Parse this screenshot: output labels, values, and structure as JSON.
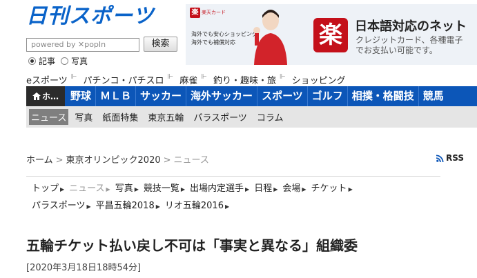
{
  "header": {
    "logo": "日刊スポーツ",
    "search_placeholder": "powered by ✕popIn",
    "search_button": "検索",
    "radio_options": [
      "記事",
      "写真"
    ],
    "radio_selected": 0
  },
  "ad": {
    "badge": "楽",
    "badge_text": "楽天カード",
    "small_lines": [
      "海外でも安心ショッピング",
      "海外でも補償対応"
    ],
    "title": "日本語対応のネット",
    "subtitle": [
      "クレジットカード、各種電子",
      "でお支払い可能です。"
    ],
    "logo_char": "楽"
  },
  "subnav": [
    "eスポーツ",
    "パチンコ・パチスロ",
    "麻雀",
    "釣り・趣味・旅",
    "ショッピング"
  ],
  "mainnav": {
    "home": "ホ…",
    "items": [
      "野球",
      "ＭＬＢ",
      "サッカー",
      "海外サッカー",
      "スポーツ",
      "ゴルフ",
      "相撲・格闘技",
      "競馬"
    ]
  },
  "subnav2": {
    "active": "ニュース",
    "items": [
      "写真",
      "紙面特集",
      "東京五輪",
      "パラスポーツ",
      "コラム"
    ]
  },
  "breadcrumb": {
    "home": "ホーム",
    "section": "東京オリンピック2020",
    "current": "ニュース",
    "rss": "RSS"
  },
  "secnav": {
    "row1": [
      "トップ",
      "ニュース",
      "写真",
      "競技一覧",
      "出場内定選手",
      "日程",
      "会場",
      "チケット"
    ],
    "row1_dim_index": 1,
    "row2": [
      "パラスポーツ",
      "平昌五輪2018",
      "リオ五輪2016"
    ]
  },
  "article": {
    "headline": "五輪チケット払い戻し不可は「事実と異なる」組織委",
    "date": "[2020年3月18日18時54分]"
  },
  "colors": {
    "brand_blue": "#0a63c9",
    "nav_blue": "#0c56b8",
    "rakuten_red": "#c4101a"
  }
}
